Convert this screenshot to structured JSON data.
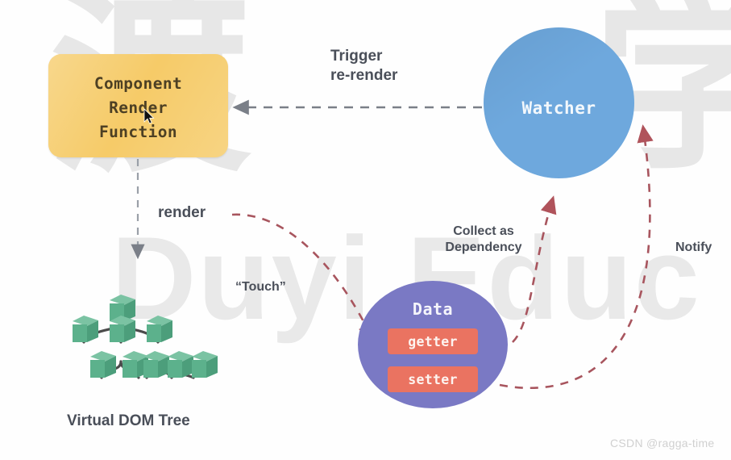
{
  "diagram": {
    "title_watermarks": {
      "cjk_left": "渡",
      "cjk_right": "学",
      "brand": "Duyi Educ",
      "credit": "CSDN @ragga-time"
    },
    "nodes": {
      "component_box": {
        "line1": "Component",
        "line2": "Render",
        "line3": "Function",
        "color": "#f5c860"
      },
      "watcher": {
        "label": "Watcher",
        "color": "#6ea8dd"
      },
      "data": {
        "label": "Data",
        "color": "#7a79c4",
        "getter": "getter",
        "setter": "setter",
        "accessor_color": "#ea7361"
      },
      "virtual_dom": {
        "label": "Virtual DOM Tree",
        "node_color": "#5cb18c"
      }
    },
    "edges": {
      "trigger": {
        "line1": "Trigger",
        "line2": "re-render",
        "color": "#7a7f88"
      },
      "render": {
        "label": "render",
        "color": "#9aa0a8"
      },
      "touch": {
        "label": "“Touch”",
        "color": "#a8555e"
      },
      "collect": {
        "label": "Collect as Dependency",
        "color": "#a8555e"
      },
      "notify": {
        "label": "Notify",
        "color": "#a8555e"
      }
    }
  }
}
